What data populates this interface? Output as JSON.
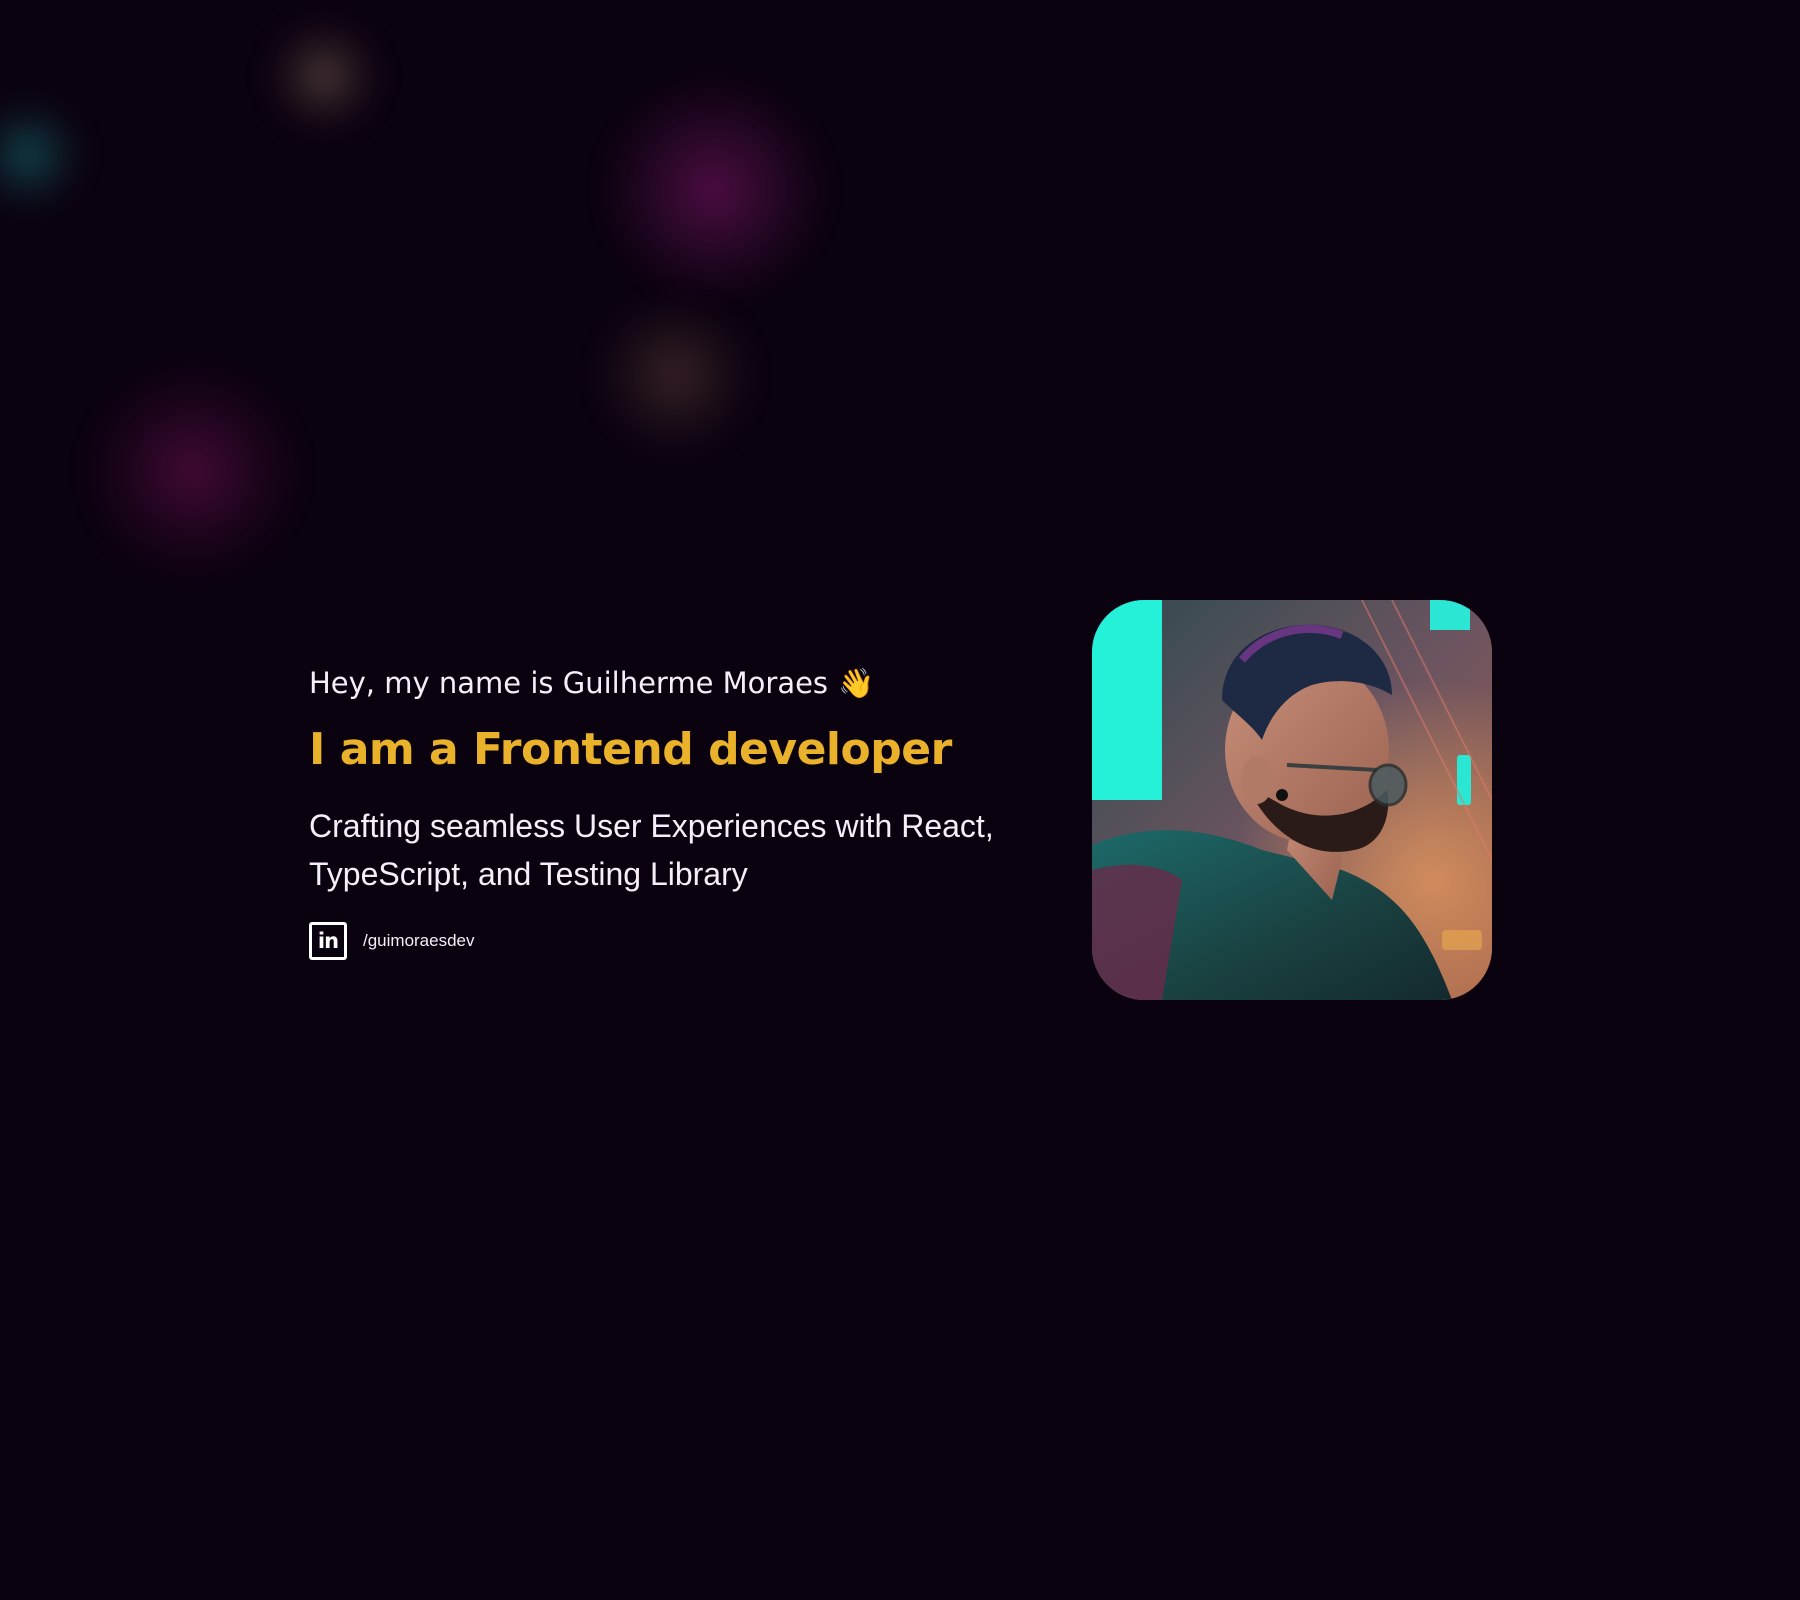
{
  "hero": {
    "greeting": "Hey, my name is Guilherme Moraes",
    "greeting_emoji": "👋",
    "role": "I am a Frontend developer",
    "tagline": "Crafting seamless User Experiences with React, TypeScript, and Testing Library"
  },
  "social": {
    "icon": "linkedin-icon",
    "icon_label": "in",
    "handle": "/guimoraesdev"
  },
  "theme": {
    "background": "#0b0210",
    "accent": "#eab12a",
    "text": "#f4f0f6"
  }
}
